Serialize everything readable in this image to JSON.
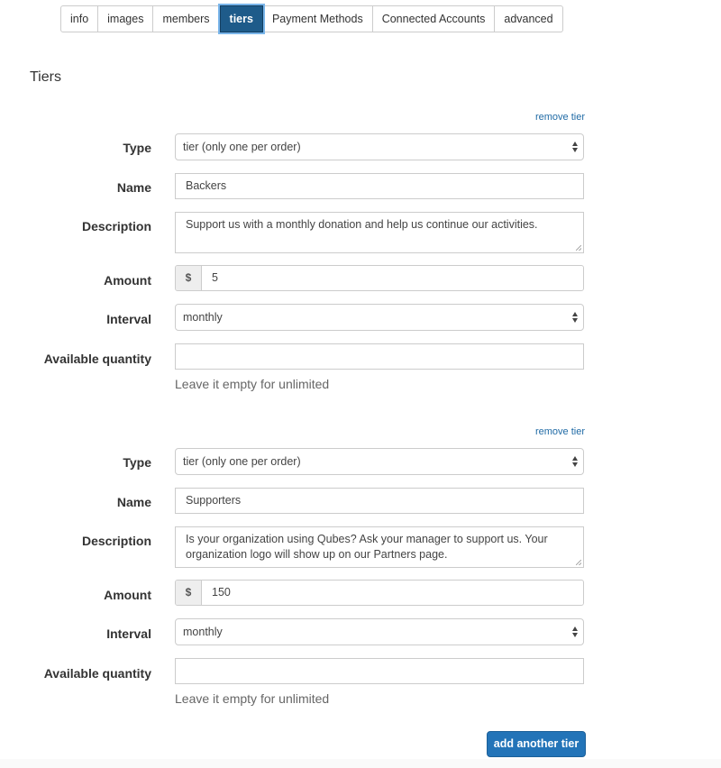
{
  "tabs": [
    {
      "label": "info",
      "active": false
    },
    {
      "label": "images",
      "active": false
    },
    {
      "label": "members",
      "active": false
    },
    {
      "label": "tiers",
      "active": true
    },
    {
      "label": "Payment Methods",
      "active": false
    },
    {
      "label": "Connected Accounts",
      "active": false
    },
    {
      "label": "advanced",
      "active": false
    }
  ],
  "section_title": "Tiers",
  "labels": {
    "type": "Type",
    "name": "Name",
    "description": "Description",
    "amount": "Amount",
    "interval": "Interval",
    "available_quantity": "Available quantity",
    "quantity_help": "Leave it empty for unlimited",
    "remove_tier": "remove tier",
    "currency_symbol": "$"
  },
  "tiers": [
    {
      "type": "tier (only one per order)",
      "name": "Backers",
      "description": "Support us with a monthly donation and help us continue our activities.",
      "amount": "5",
      "interval": "monthly",
      "available_quantity": ""
    },
    {
      "type": "tier (only one per order)",
      "name": "Supporters",
      "description": "Is your organization using Qubes? Ask your manager to support us. Your organization logo will show up on our Partners page.",
      "amount": "150",
      "interval": "monthly",
      "available_quantity": ""
    }
  ],
  "add_button_label": "add another tier",
  "colors": {
    "active_tab": "#1e5b8a",
    "link": "#1f6aa5",
    "primary_button": "#2374b8"
  }
}
